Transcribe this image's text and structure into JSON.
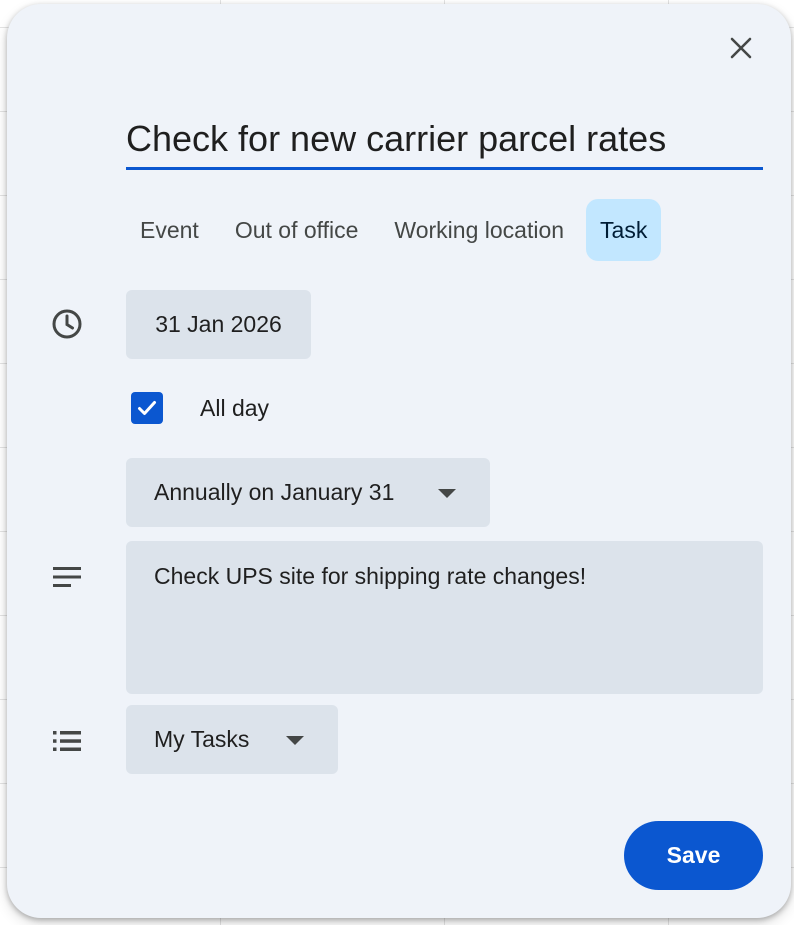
{
  "dialog": {
    "title_value": "Check for new carrier parcel rates",
    "tabs": [
      {
        "label": "Event",
        "active": false
      },
      {
        "label": "Out of office",
        "active": false
      },
      {
        "label": "Working location",
        "active": false
      },
      {
        "label": "Task",
        "active": true
      }
    ],
    "date": "31 Jan 2026",
    "all_day": {
      "label": "All day",
      "checked": true
    },
    "recurrence": {
      "selected": "Annually on January 31"
    },
    "description": "Check UPS site for shipping rate changes!",
    "task_list": {
      "selected": "My Tasks"
    },
    "save_label": "Save",
    "icons": {
      "close": "close-icon",
      "time": "clock-icon",
      "description": "notes-icon",
      "task_list": "list-icon",
      "checkbox": "checkmark-icon",
      "dropdown": "caret-down-icon"
    },
    "colors": {
      "accent": "#0b57d0",
      "active_tab": "#c2e7ff",
      "surface": "#eff3f9",
      "field": "#dce3eb"
    }
  }
}
